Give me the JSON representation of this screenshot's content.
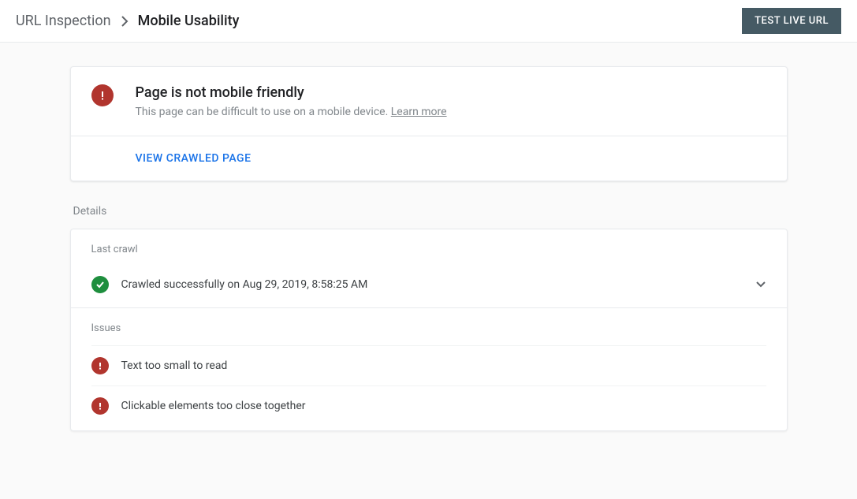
{
  "breadcrumb": {
    "parent": "URL Inspection",
    "current": "Mobile Usability"
  },
  "header": {
    "test_button": "TEST LIVE URL"
  },
  "status": {
    "title": "Page is not mobile friendly",
    "subtitle": "This page can be difficult to use on a mobile device. ",
    "learn_more": "Learn more",
    "view_crawled": "VIEW CRAWLED PAGE"
  },
  "details": {
    "label": "Details",
    "last_crawl_heading": "Last crawl",
    "crawl_status": "Crawled successfully on Aug 29, 2019, 8:58:25 AM",
    "issues_heading": "Issues",
    "issues": [
      {
        "text": "Text too small to read"
      },
      {
        "text": "Clickable elements too close together"
      }
    ]
  }
}
